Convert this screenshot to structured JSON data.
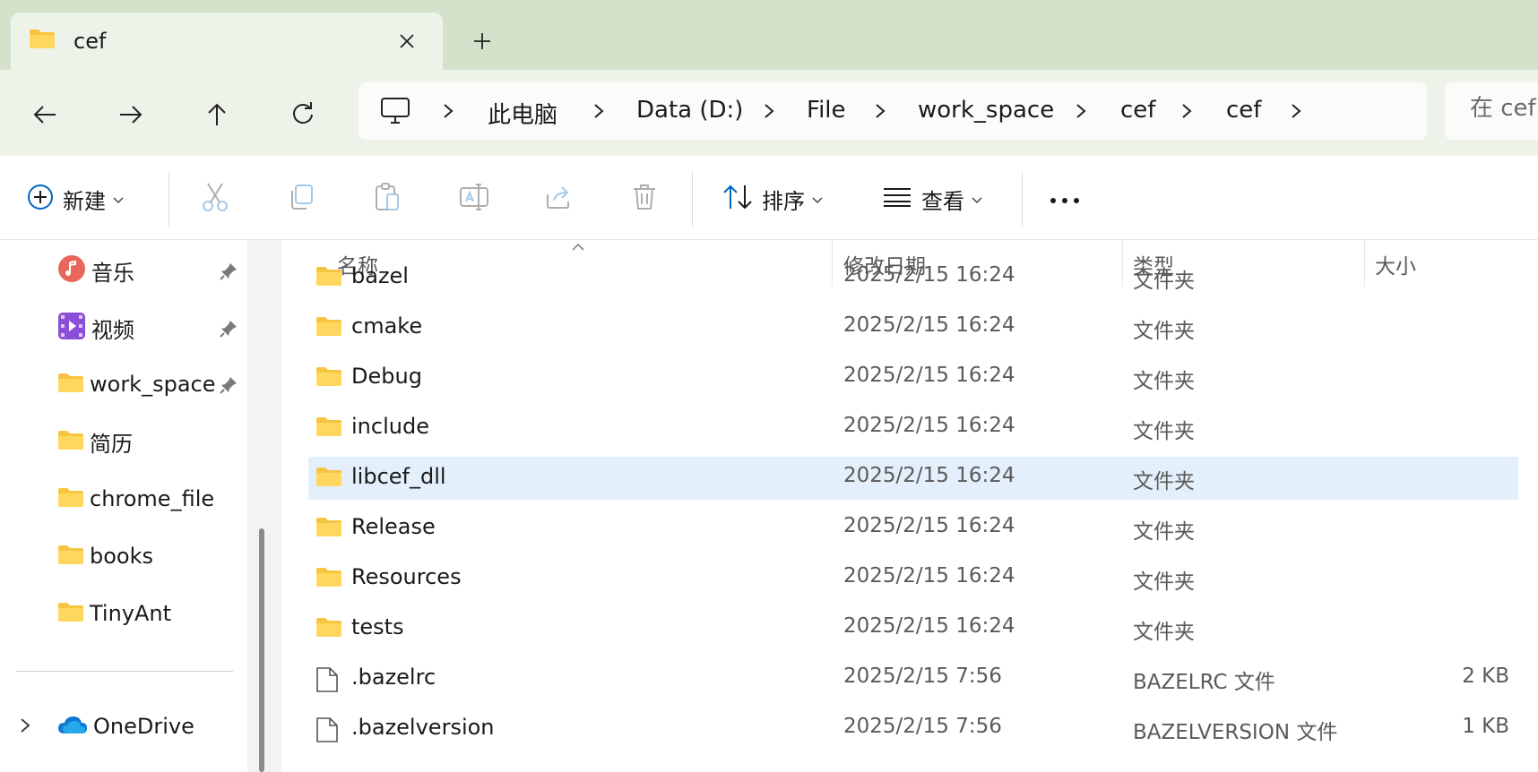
{
  "colors": {
    "accent": "#0067c0",
    "tabstrip": "#d4e2cc",
    "chrome": "#eef3ea",
    "selected_row": "#e3f0fb",
    "folder": "#f5c542"
  },
  "tab": {
    "title": "cef",
    "icon": "folder-icon",
    "close_icon": "close-icon",
    "new_tab_icon": "plus-icon"
  },
  "nav": {
    "back_icon": "arrow-left-icon",
    "forward_icon": "arrow-right-icon",
    "up_icon": "arrow-up-icon",
    "refresh_icon": "refresh-icon"
  },
  "breadcrumb": [
    "此电脑",
    "Data (D:)",
    "File",
    "work_space",
    "cef",
    "cef"
  ],
  "search": {
    "placeholder": "在 cef 中搜索"
  },
  "toolbar": {
    "new_label": "新建",
    "sort_label": "排序",
    "view_label": "查看"
  },
  "sidebar": {
    "items": [
      {
        "label": "音乐",
        "icon": "music-icon",
        "pinned": true
      },
      {
        "label": "视频",
        "icon": "video-icon",
        "pinned": true
      },
      {
        "label": "work_space",
        "icon": "folder-icon",
        "pinned": true
      },
      {
        "label": "简历",
        "icon": "folder-icon",
        "pinned": false
      },
      {
        "label": "chrome_file",
        "icon": "folder-icon",
        "pinned": false
      },
      {
        "label": "books",
        "icon": "folder-icon",
        "pinned": false
      },
      {
        "label": "TinyAnt",
        "icon": "folder-icon",
        "pinned": false
      }
    ],
    "onedrive_label": "OneDrive"
  },
  "columns": {
    "name": "名称",
    "modified": "修改日期",
    "type": "类型",
    "size": "大小"
  },
  "files": [
    {
      "name": "bazel",
      "modified": "2025/2/15 16:24",
      "type": "文件夹",
      "size": "",
      "kind": "folder"
    },
    {
      "name": "cmake",
      "modified": "2025/2/15 16:24",
      "type": "文件夹",
      "size": "",
      "kind": "folder"
    },
    {
      "name": "Debug",
      "modified": "2025/2/15 16:24",
      "type": "文件夹",
      "size": "",
      "kind": "folder"
    },
    {
      "name": "include",
      "modified": "2025/2/15 16:24",
      "type": "文件夹",
      "size": "",
      "kind": "folder"
    },
    {
      "name": "libcef_dll",
      "modified": "2025/2/15 16:24",
      "type": "文件夹",
      "size": "",
      "kind": "folder",
      "selected": true
    },
    {
      "name": "Release",
      "modified": "2025/2/15 16:24",
      "type": "文件夹",
      "size": "",
      "kind": "folder"
    },
    {
      "name": "Resources",
      "modified": "2025/2/15 16:24",
      "type": "文件夹",
      "size": "",
      "kind": "folder"
    },
    {
      "name": "tests",
      "modified": "2025/2/15 16:24",
      "type": "文件夹",
      "size": "",
      "kind": "folder"
    },
    {
      "name": ".bazelrc",
      "modified": "2025/2/15 7:56",
      "type": "BAZELRC 文件",
      "size": "2 KB",
      "kind": "file"
    },
    {
      "name": ".bazelversion",
      "modified": "2025/2/15 7:56",
      "type": "BAZELVERSION 文件",
      "size": "1 KB",
      "kind": "file"
    }
  ]
}
